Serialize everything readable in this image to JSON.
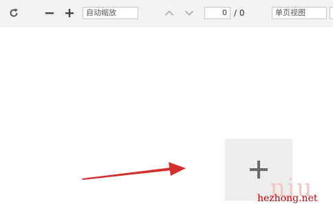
{
  "toolbar": {
    "refresh_icon": "refresh-icon",
    "zoom_out_icon": "minus-icon",
    "zoom_in_icon": "plus-icon",
    "zoom_select_value": "自动缩放",
    "prev_page_icon": "chevron-up-icon",
    "next_page_icon": "chevron-down-icon",
    "page_number": "0",
    "page_total": "/ 0",
    "view_mode_value": "单页视图"
  },
  "main": {
    "add_icon": "plus-icon"
  },
  "annotation": {
    "arrow_color": "#d62e2e"
  },
  "watermark": {
    "text": "hezhong.net",
    "overlay": "niu"
  }
}
